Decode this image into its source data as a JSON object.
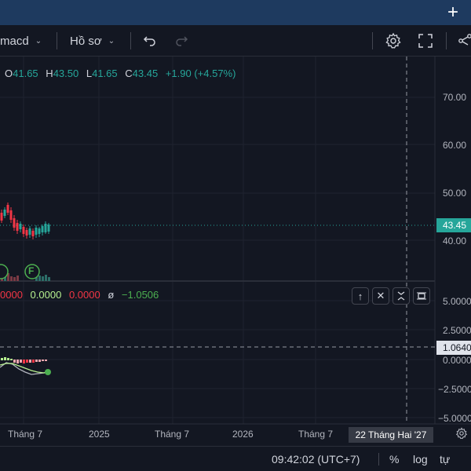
{
  "toolbar": {
    "indicator_label": "macd",
    "profile_label": "Hồ sơ"
  },
  "ohlc": {
    "o_label": "O",
    "o_value": "41.65",
    "h_label": "H",
    "h_value": "43.50",
    "l_label": "L",
    "l_value": "41.65",
    "c_label": "C",
    "c_value": "43.45",
    "change": "+1.90 (+4.57%)"
  },
  "macd_legend": {
    "v1": "0000",
    "v2": "0.0000",
    "v3": "0.0000",
    "symbol": "ø",
    "v4": "−1.0506"
  },
  "price_axis": {
    "labels": [
      "70.00",
      "60.00",
      "50.00",
      "40.00"
    ],
    "current_price": "43.45",
    "macd_labels": [
      "5.0000",
      "2.5000",
      "0.0000",
      "−2.5000",
      "−5.0000"
    ],
    "crosshair_value": "1.0640"
  },
  "time_axis": {
    "labels": [
      "Tháng 7",
      "2025",
      "Tháng 7",
      "2026",
      "Tháng 7"
    ],
    "crosshair_date": "22 Tháng Hai '27"
  },
  "statusbar": {
    "time": "09:42:02 (UTC+7)",
    "percent": "%",
    "log": "log",
    "auto": "tự độn"
  },
  "markers": [
    "F"
  ],
  "colors": {
    "bg": "#131722",
    "up": "#26a69a",
    "down": "#f23645",
    "topbar": "#1e3a5f"
  }
}
